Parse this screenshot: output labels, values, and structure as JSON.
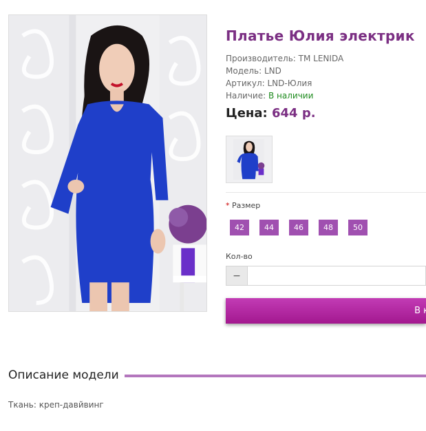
{
  "product": {
    "title": "Платье Юлия электрик",
    "manufacturer_label": "Производитель: ",
    "manufacturer": "TM LENIDA",
    "model_label": "Модель: ",
    "model": "LND",
    "sku_label": "Артикул: ",
    "sku": "LND-Юлия",
    "availability_label": "Наличие: ",
    "availability": "В наличии",
    "price_label": "Цена:",
    "price": "644 р."
  },
  "options": {
    "size_required_mark": "*",
    "size_label": "Размер",
    "sizes": [
      "42",
      "44",
      "46",
      "48",
      "50"
    ],
    "qty_label": "Кол-во",
    "qty_minus": "−",
    "qty_value": ""
  },
  "cart": {
    "button_label": "В к"
  },
  "description": {
    "title": "Описание модели",
    "fabric": "Ткань: креп-давйвинг"
  },
  "colors": {
    "accent": "#7b2f83",
    "size_button": "#a050b0",
    "cart_button": "#b0259f",
    "in_stock": "#1d8a1d",
    "dress": "#1f3fc9"
  }
}
